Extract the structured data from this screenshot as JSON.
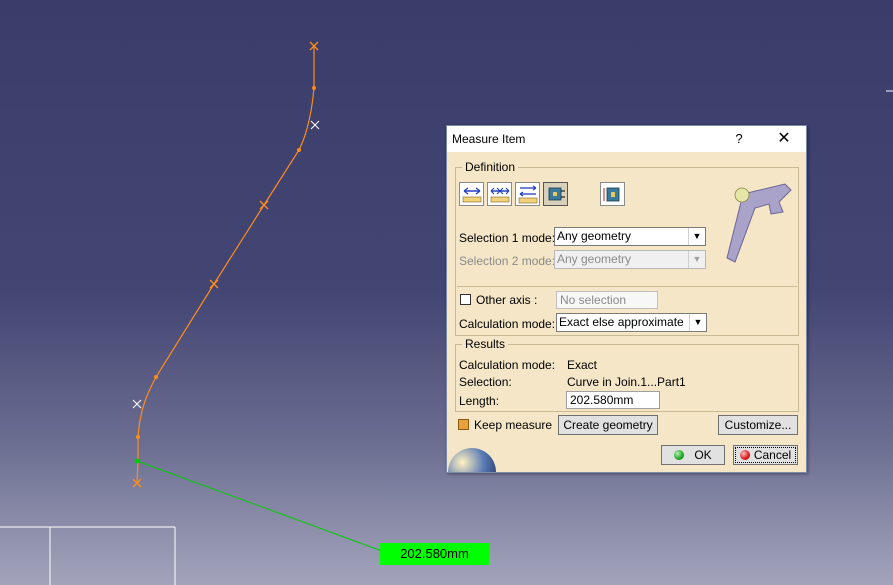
{
  "viewport": {
    "dimension_label": "202.580mm",
    "accent_curve_color": "#ff8c1a",
    "dimension_line_color": "#00cc00"
  },
  "dialog": {
    "title": "Measure Item",
    "help_label": "?",
    "close_label": "✕",
    "definition": {
      "group_label": "Definition",
      "tools": [
        "measure-between-icon",
        "measure-between-chained-icon",
        "measure-between-fan-icon",
        "measure-item-icon",
        "measure-thickness-icon"
      ],
      "selection1_label": "Selection 1 mode:",
      "selection1_value": "Any geometry",
      "selection2_label": "Selection 2 mode:",
      "selection2_value": "Any geometry",
      "other_axis_label": "Other axis :",
      "other_axis_value": "No selection",
      "calc_mode_label": "Calculation mode:",
      "calc_mode_value": "Exact else approximate"
    },
    "results": {
      "group_label": "Results",
      "calc_mode_label": "Calculation mode:",
      "calc_mode_value": "Exact",
      "selection_label": "Selection:",
      "selection_value": "Curve in Join.1...Part1",
      "length_label": "Length:",
      "length_value": "202.580mm"
    },
    "keep_measure_label": "Keep measure",
    "create_geometry_label": "Create geometry",
    "customize_label": "Customize...",
    "ok_label": "OK",
    "cancel_label": "Cancel",
    "ok_dot_color": "#1aa51a",
    "cancel_dot_color": "#d81818"
  }
}
